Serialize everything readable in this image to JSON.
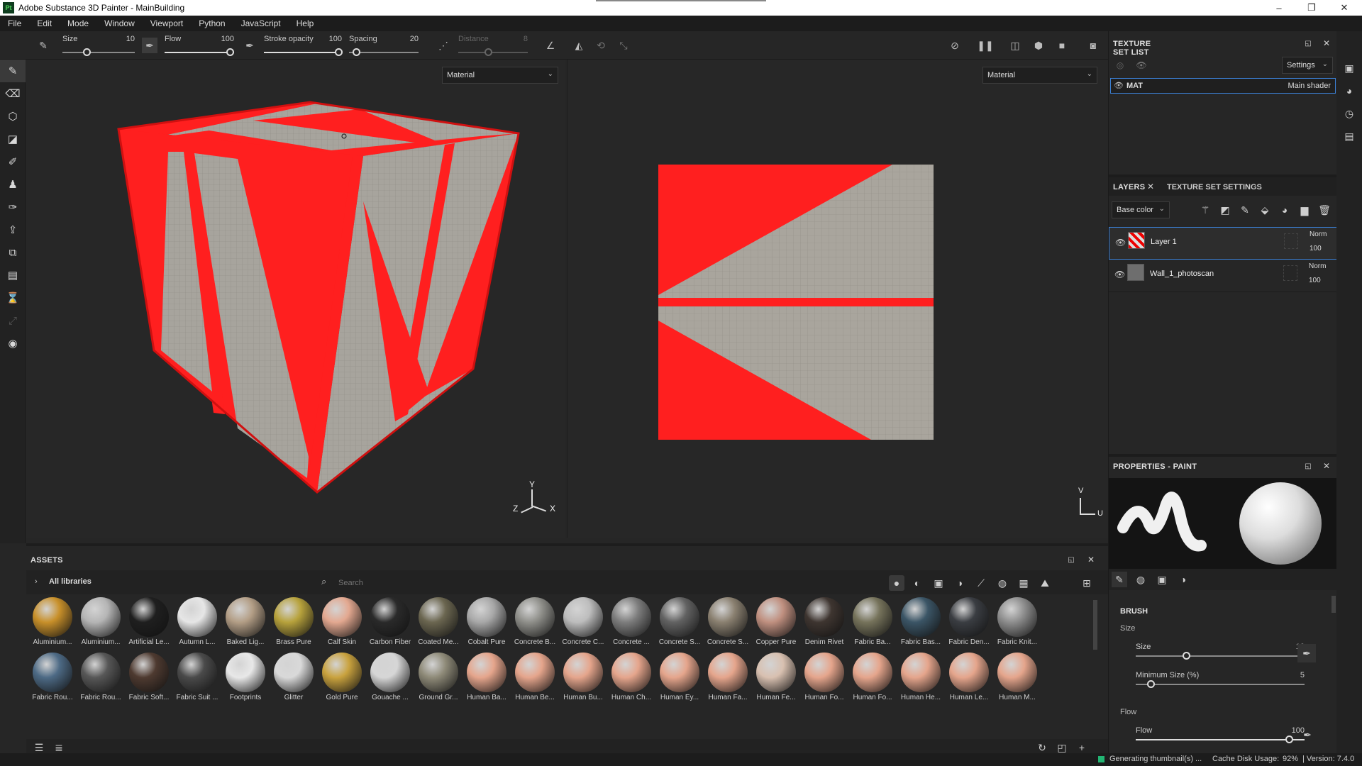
{
  "app": {
    "title": "Adobe Substance 3D Painter - MainBuilding",
    "icon_text": "Pt"
  },
  "window_controls": {
    "minimize": "–",
    "restore": "❐",
    "close": "✕"
  },
  "menu": [
    "File",
    "Edit",
    "Mode",
    "Window",
    "Viewport",
    "Python",
    "JavaScript",
    "Help"
  ],
  "toolbar": {
    "size_label": "Size",
    "size_value": "10",
    "flow_label": "Flow",
    "flow_value": "100",
    "stroke_label": "Stroke opacity",
    "stroke_value": "100",
    "spacing_label": "Spacing",
    "spacing_value": "20",
    "distance_label": "Distance",
    "distance_value": "8"
  },
  "viewport3d": {
    "mode": "Material",
    "axis_y": "Y",
    "axis_x": "X",
    "axis_z": "Z"
  },
  "viewport2d": {
    "mode": "Material",
    "axis_v": "V",
    "axis_u": "U"
  },
  "texture_set_list": {
    "title": "TEXTURE SET LIST",
    "settings_label": "Settings",
    "item_name": "MAT",
    "item_shader": "Main shader"
  },
  "layers": {
    "tab_layers": "LAYERS",
    "tab_tss": "TEXTURE SET SETTINGS",
    "channel": "Base color",
    "items": [
      {
        "name": "Layer 1",
        "blend": "Norm",
        "opacity": "100"
      },
      {
        "name": "Wall_1_photoscan",
        "blend": "Norm",
        "opacity": "100"
      }
    ]
  },
  "properties": {
    "title": "PROPERTIES - PAINT",
    "brush_header": "BRUSH",
    "size_group": "Size",
    "size_label": "Size",
    "size_value": "10",
    "min_size_label": "Minimum Size (%)",
    "min_size_value": "5",
    "flow_group": "Flow",
    "flow_label": "Flow",
    "flow_value": "100"
  },
  "assets": {
    "title": "ASSETS",
    "library": "All libraries",
    "search_placeholder": "Search",
    "row1": [
      {
        "label": "Aluminium...",
        "color": "#c8902a"
      },
      {
        "label": "Aluminium...",
        "color": "#b5b5b5"
      },
      {
        "label": "Artificial Le...",
        "color": "#1f1f1f"
      },
      {
        "label": "Autumn L...",
        "color": "#e6e6e6"
      },
      {
        "label": "Baked Lig...",
        "color": "#b39e86"
      },
      {
        "label": "Brass Pure",
        "color": "#b7a23c"
      },
      {
        "label": "Calf Skin",
        "color": "#e3a890"
      },
      {
        "label": "Carbon Fiber",
        "color": "#2a2a2a"
      },
      {
        "label": "Coated Me...",
        "color": "#6b6650"
      },
      {
        "label": "Cobalt Pure",
        "color": "#a8a8a8"
      },
      {
        "label": "Concrete B...",
        "color": "#8f8f8a"
      },
      {
        "label": "Concrete C...",
        "color": "#bdbdbd"
      },
      {
        "label": "Concrete ...",
        "color": "#7d7d7d"
      },
      {
        "label": "Concrete S...",
        "color": "#626262"
      },
      {
        "label": "Concrete S...",
        "color": "#8a8070"
      },
      {
        "label": "Copper Pure",
        "color": "#c09080"
      },
      {
        "label": "Denim Rivet",
        "color": "#3e3530"
      },
      {
        "label": "Fabric Ba...",
        "color": "#76735b"
      },
      {
        "label": "Fabric Bas...",
        "color": "#3b5566"
      },
      {
        "label": "Fabric Den...",
        "color": "#3a3d42"
      },
      {
        "label": "Fabric Knit...",
        "color": "#8e8e8e"
      }
    ],
    "row2": [
      {
        "label": "Fabric Rou...",
        "color": "#4d6a85"
      },
      {
        "label": "Fabric Rou...",
        "color": "#575757"
      },
      {
        "label": "Fabric Soft...",
        "color": "#4e3a30"
      },
      {
        "label": "Fabric Suit ...",
        "color": "#4a4a4a"
      },
      {
        "label": "Footprints",
        "color": "#e8e8e8"
      },
      {
        "label": "Glitter",
        "color": "#d9d9d9"
      },
      {
        "label": "Gold Pure",
        "color": "#c9a23e"
      },
      {
        "label": "Gouache ...",
        "color": "#d6d6d6"
      },
      {
        "label": "Ground Gr...",
        "color": "#8e8a78"
      },
      {
        "label": "Human Ba...",
        "color": "#e5a58c"
      },
      {
        "label": "Human Be...",
        "color": "#e5a58c"
      },
      {
        "label": "Human Bu...",
        "color": "#e5a58c"
      },
      {
        "label": "Human Ch...",
        "color": "#e5a58c"
      },
      {
        "label": "Human Ey...",
        "color": "#e5a58c"
      },
      {
        "label": "Human Fa...",
        "color": "#e5a58c"
      },
      {
        "label": "Human Fe...",
        "color": "#d8c0b0"
      },
      {
        "label": "Human Fo...",
        "color": "#e5a58c"
      },
      {
        "label": "Human Fo...",
        "color": "#e5a58c"
      },
      {
        "label": "Human He...",
        "color": "#e5a58c"
      },
      {
        "label": "Human Le...",
        "color": "#e5a58c"
      },
      {
        "label": "Human M...",
        "color": "#e5a58c"
      }
    ]
  },
  "status": {
    "message": "Generating thumbnail(s) ...",
    "cache": "Cache Disk Usage:",
    "cache_value": "92%",
    "version": "| Version: 7.4.0"
  },
  "colors": {
    "accent_red": "#ff1f1f",
    "wall_gray": "#a8a49c",
    "selection_blue": "#3b7fd4",
    "panel": "#262626"
  }
}
